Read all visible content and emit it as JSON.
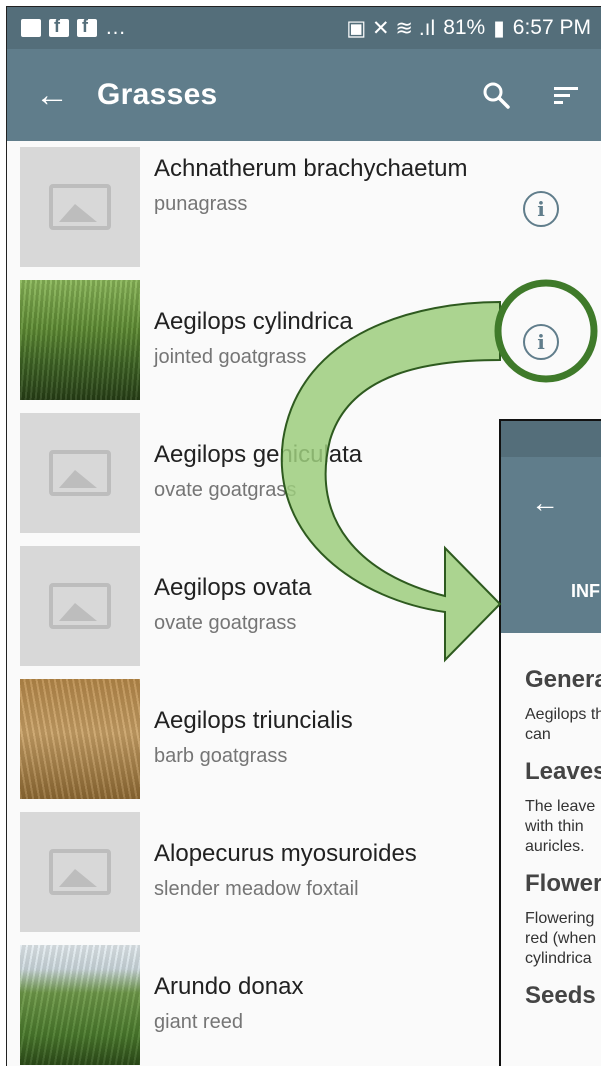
{
  "status_bar": {
    "battery": "81%",
    "time": "6:57 PM"
  },
  "app_bar": {
    "title": "Grasses",
    "back_icon": "arrow-left-icon",
    "search_icon": "search-icon",
    "sort_icon": "sort-icon"
  },
  "species": [
    {
      "name": "Achnatherum brachychaetum",
      "common": "punagrass",
      "image": "placeholder"
    },
    {
      "name": "Aegilops cylindrica",
      "common": "jointed goatgrass",
      "image": "photo"
    },
    {
      "name": "Aegilops geniculata",
      "common": "ovate goatgrass",
      "image": "placeholder"
    },
    {
      "name": "Aegilops ovata",
      "common": "ovate goatgrass",
      "image": "placeholder"
    },
    {
      "name": "Aegilops triuncialis",
      "common": "barb goatgrass",
      "image": "photo"
    },
    {
      "name": "Alopecurus myosuroides",
      "common": "slender meadow foxtail",
      "image": "placeholder"
    },
    {
      "name": "Arundo donax",
      "common": "giant reed",
      "image": "photo"
    }
  ],
  "detail_preview": {
    "tab": "INF",
    "heading_general": "Genera",
    "text_general": "Aegilops that can",
    "heading_leaves": "Leaves",
    "text_leaves": "The leave with thin auricles.",
    "heading_flowers": "Flower",
    "text_flowers": "Flowering red (when cylindrica",
    "heading_seeds": "Seeds"
  },
  "colors": {
    "appbar": "#607d8b",
    "statusbar": "#546e7a",
    "highlight_ring": "#3f7a2a",
    "arrow_fill": "#9ccc7c"
  }
}
